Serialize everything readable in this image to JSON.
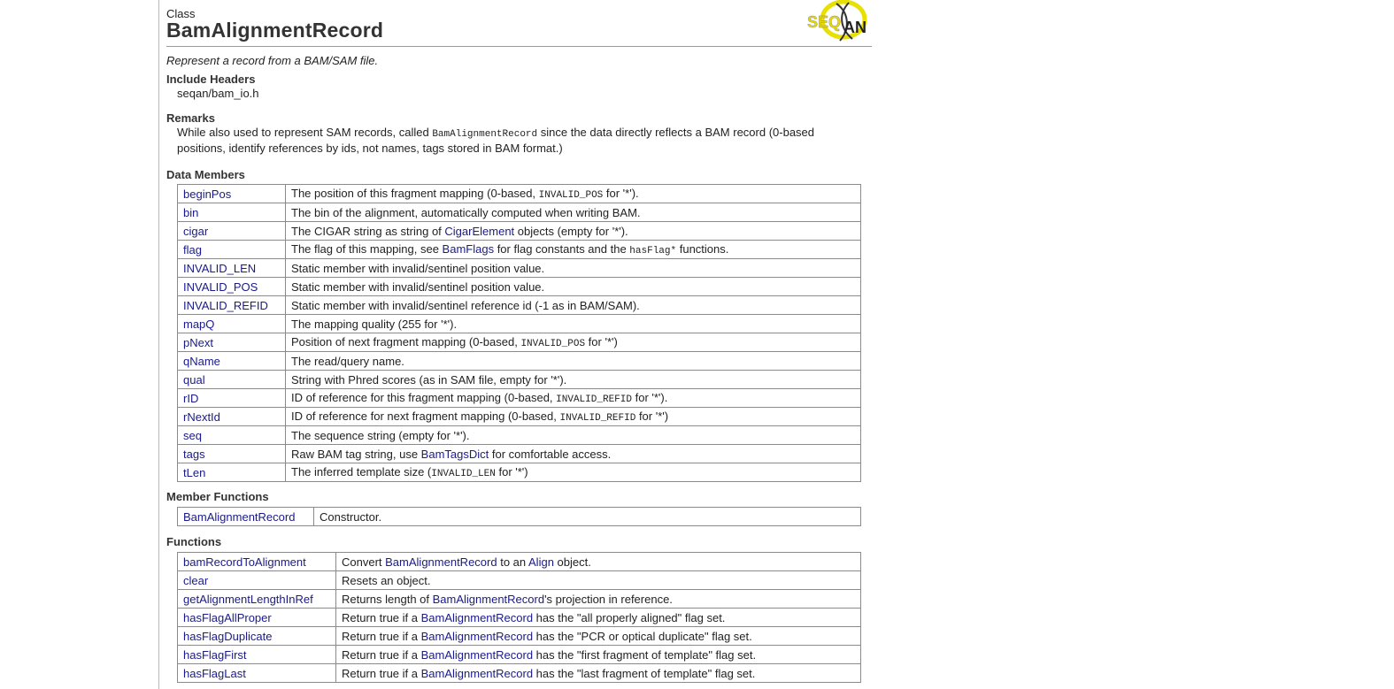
{
  "header": {
    "kind": "Class",
    "title": "BamAlignmentRecord",
    "logo_alt": "SeqAn logo"
  },
  "brief": "Represent a record from a BAM/SAM file.",
  "include": {
    "heading": "Include Headers",
    "value": "seqan/bam_io.h"
  },
  "remarks": {
    "heading": "Remarks",
    "line1_pre": "While also used to represent SAM records, called ",
    "line1_code": "BamAlignmentRecord",
    "line1_post": " since the data directly reflects a BAM record (0-based",
    "line2": "positions, identify references by ids, not names, tags stored in BAM format.)"
  },
  "data_members": {
    "heading": "Data Members",
    "rows": [
      {
        "name": "beginPos",
        "desc": [
          {
            "t": "The position of this fragment mapping (0-based, "
          },
          {
            "c": "INVALID_POS"
          },
          {
            "t": " for '*')."
          }
        ]
      },
      {
        "name": "bin",
        "desc": [
          {
            "t": "The bin of the alignment, automatically computed when writing BAM."
          }
        ]
      },
      {
        "name": "cigar",
        "desc": [
          {
            "t": "The CIGAR string as string of "
          },
          {
            "l": "CigarElement"
          },
          {
            "t": " objects (empty for '*')."
          }
        ]
      },
      {
        "name": "flag",
        "desc": [
          {
            "t": "The flag of this mapping, see "
          },
          {
            "l": "BamFlags"
          },
          {
            "t": " for flag constants and the "
          },
          {
            "c": "hasFlag*"
          },
          {
            "t": " functions."
          }
        ]
      },
      {
        "name": "INVALID_LEN",
        "desc": [
          {
            "t": "Static member with invalid/sentinel position value."
          }
        ]
      },
      {
        "name": "INVALID_POS",
        "desc": [
          {
            "t": "Static member with invalid/sentinel position value."
          }
        ]
      },
      {
        "name": "INVALID_REFID",
        "desc": [
          {
            "t": "Static member with invalid/sentinel reference id (-1 as in BAM/SAM)."
          }
        ]
      },
      {
        "name": "mapQ",
        "desc": [
          {
            "t": "The mapping quality (255 for '*')."
          }
        ]
      },
      {
        "name": "pNext",
        "desc": [
          {
            "t": "Position of next fragment mapping (0-based, "
          },
          {
            "c": "INVALID_POS"
          },
          {
            "t": " for '*')"
          }
        ]
      },
      {
        "name": "qName",
        "desc": [
          {
            "t": "The read/query name."
          }
        ]
      },
      {
        "name": "qual",
        "desc": [
          {
            "t": "String with Phred scores (as in SAM file, empty for '*')."
          }
        ]
      },
      {
        "name": "rID",
        "desc": [
          {
            "t": "ID of reference for this fragment mapping (0-based, "
          },
          {
            "c": "INVALID_REFID"
          },
          {
            "t": " for '*')."
          }
        ]
      },
      {
        "name": "rNextId",
        "desc": [
          {
            "t": "ID of reference for next fragment mapping (0-based, "
          },
          {
            "c": "INVALID_REFID"
          },
          {
            "t": " for '*')"
          }
        ]
      },
      {
        "name": "seq",
        "desc": [
          {
            "t": "The sequence string (empty for '*')."
          }
        ]
      },
      {
        "name": "tags",
        "desc": [
          {
            "t": "Raw BAM tag string, use "
          },
          {
            "l": "BamTagsDict"
          },
          {
            "t": " for comfortable access."
          }
        ]
      },
      {
        "name": "tLen",
        "desc": [
          {
            "t": "The inferred template size ("
          },
          {
            "c": "INVALID_LEN"
          },
          {
            "t": " for '*')"
          }
        ]
      }
    ]
  },
  "member_functions": {
    "heading": "Member Functions",
    "rows": [
      {
        "name": "BamAlignmentRecord",
        "desc": [
          {
            "t": "Constructor."
          }
        ]
      }
    ]
  },
  "functions": {
    "heading": "Functions",
    "rows": [
      {
        "name": "bamRecordToAlignment",
        "desc": [
          {
            "t": "Convert "
          },
          {
            "l": "BamAlignmentRecord"
          },
          {
            "t": " to an "
          },
          {
            "l": "Align"
          },
          {
            "t": " object."
          }
        ]
      },
      {
        "name": "clear",
        "desc": [
          {
            "t": "Resets an object."
          }
        ]
      },
      {
        "name": "getAlignmentLengthInRef",
        "desc": [
          {
            "t": "Returns length of "
          },
          {
            "l": "BamAlignmentRecord"
          },
          {
            "t": "'s projection in reference."
          }
        ]
      },
      {
        "name": "hasFlagAllProper",
        "desc": [
          {
            "t": "Return true if a "
          },
          {
            "l": "BamAlignmentRecord"
          },
          {
            "t": " has the \"all properly aligned\" flag set."
          }
        ]
      },
      {
        "name": "hasFlagDuplicate",
        "desc": [
          {
            "t": "Return true if a "
          },
          {
            "l": "BamAlignmentRecord"
          },
          {
            "t": " has the \"PCR or optical duplicate\" flag set."
          }
        ]
      },
      {
        "name": "hasFlagFirst",
        "desc": [
          {
            "t": "Return true if a "
          },
          {
            "l": "BamAlignmentRecord"
          },
          {
            "t": " has the \"first fragment of template\" flag set."
          }
        ]
      },
      {
        "name": "hasFlagLast",
        "desc": [
          {
            "t": "Return true if a "
          },
          {
            "l": "BamAlignmentRecord"
          },
          {
            "t": " has the \"last fragment of template\" flag set."
          }
        ]
      }
    ]
  }
}
